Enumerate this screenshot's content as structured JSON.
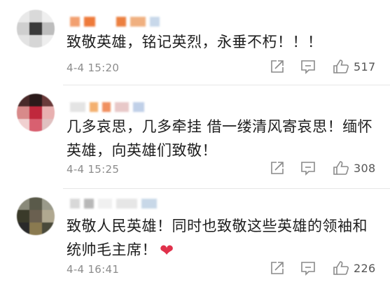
{
  "comments": [
    {
      "text": "致敬英雄，铭记英烈，永垂不朽！！！",
      "time": "4-4 15:20",
      "likes": "517"
    },
    {
      "text": "几多哀思，几多牵挂 借一缕清风寄哀思！缅怀英雄，向英雄们致敬！",
      "time": "4-4 15:25",
      "likes": "308"
    },
    {
      "text": "致敬人民英雄！同时也致敬这些英雄的领袖和统帅毛主席！",
      "emoji": "❤",
      "time": "4-4 16:41",
      "likes": "226"
    }
  ],
  "icons": {
    "share": "share-icon",
    "reply": "comment-icon",
    "like": "thumbs-up-icon"
  },
  "colors": {
    "heart": "#e0314b",
    "meta_text": "#8c8c8c",
    "icon": "#8a8a8a"
  }
}
